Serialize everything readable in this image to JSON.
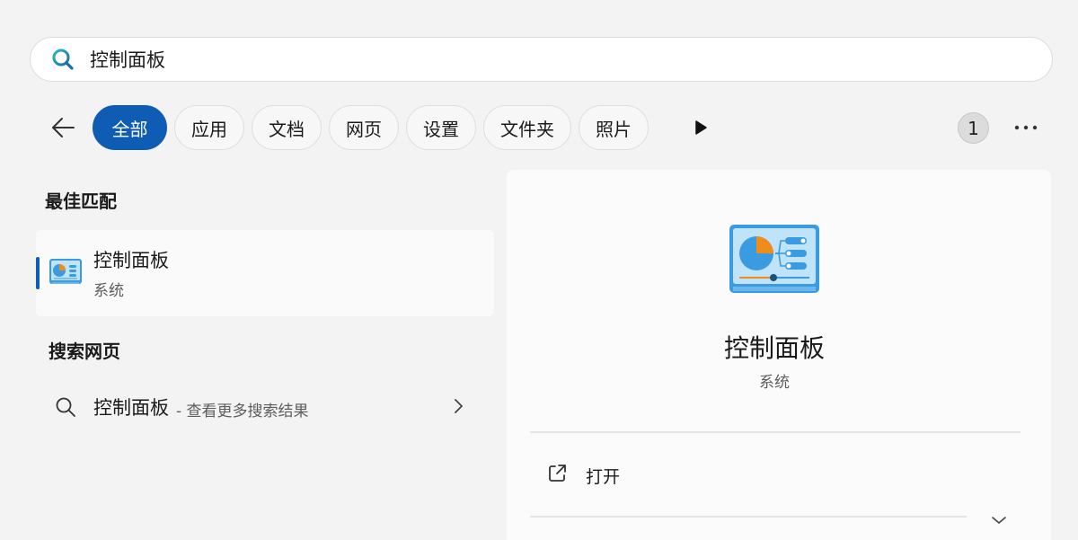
{
  "search": {
    "query": "控制面板"
  },
  "filters": {
    "chips": [
      "全部",
      "应用",
      "文档",
      "网页",
      "设置",
      "文件夹",
      "照片"
    ],
    "active_index": 0,
    "result_count": "1"
  },
  "best_match": {
    "heading": "最佳匹配",
    "item": {
      "name": "控制面板",
      "category": "系统"
    }
  },
  "web_search": {
    "heading": "搜索网页",
    "query": "控制面板",
    "suffix": "- 查看更多搜索结果"
  },
  "detail": {
    "title": "控制面板",
    "subtitle": "系统",
    "actions": [
      {
        "label": "打开",
        "icon": "open-external-icon"
      }
    ]
  },
  "colors": {
    "accent": "#0f5cb4",
    "search_icon": "#1a8aa0",
    "icon_blue": "#3a9be0",
    "icon_orange": "#f08c1a"
  }
}
